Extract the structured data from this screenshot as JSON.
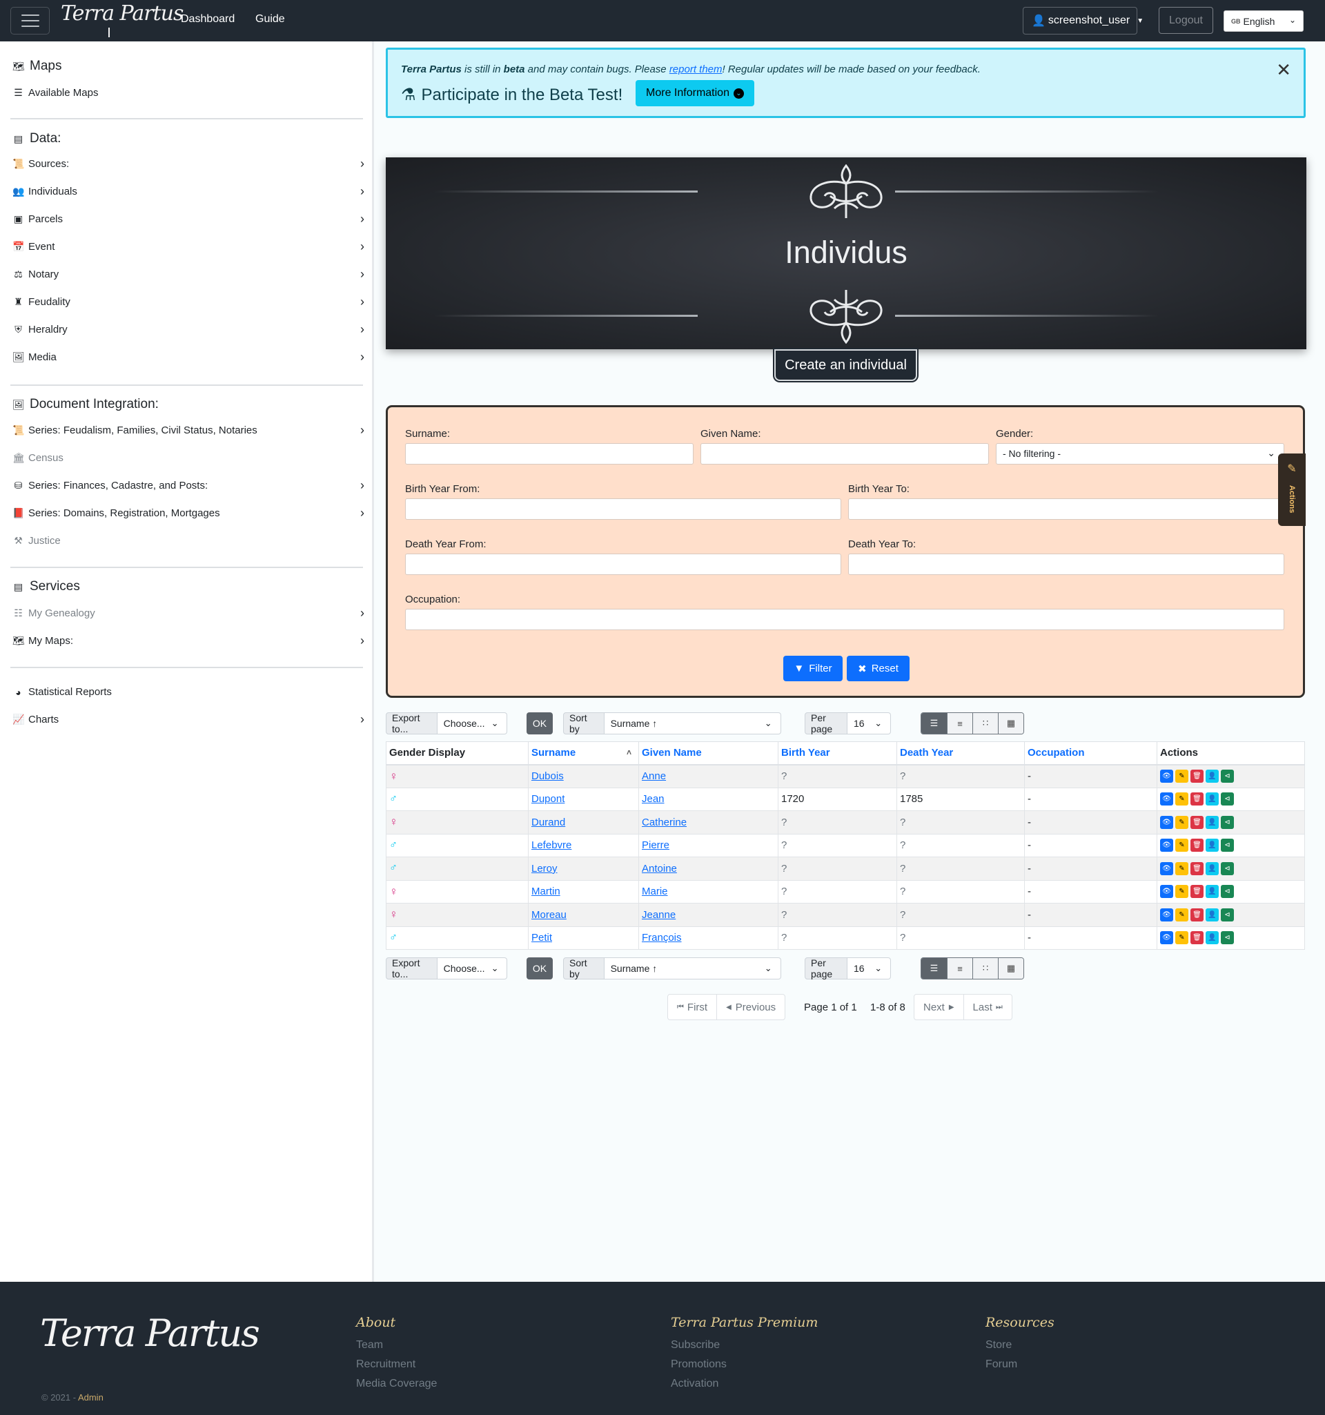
{
  "navbar": {
    "brand": "Terra Partus",
    "links": [
      "Dashboard",
      "Guide"
    ],
    "user": "screenshot_user",
    "logout": "Logout",
    "language": {
      "flag": "GB",
      "label": "English"
    }
  },
  "sidebar": {
    "maps_heading": "Maps",
    "available_maps": "Available Maps",
    "data_heading": "Data:",
    "data_items": [
      {
        "label": "Sources:",
        "icon": "scroll-icon"
      },
      {
        "label": "Individuals",
        "icon": "users-icon"
      },
      {
        "label": "Parcels",
        "icon": "parcel-icon"
      },
      {
        "label": "Event",
        "icon": "calendar-icon"
      },
      {
        "label": "Notary",
        "icon": "scale-icon"
      },
      {
        "label": "Feudality",
        "icon": "castle-icon"
      },
      {
        "label": "Heraldry",
        "icon": "shield-icon"
      },
      {
        "label": "Media",
        "icon": "images-icon"
      }
    ],
    "doc_heading": "Document Integration:",
    "doc_items": [
      {
        "label": "Series: Feudalism, Families, Civil Status, Notaries",
        "arrow": true,
        "muted": false
      },
      {
        "label": "Census",
        "arrow": false,
        "muted": true
      },
      {
        "label": "Series: Finances, Cadastre, and Posts:",
        "arrow": true,
        "muted": false
      },
      {
        "label": "Series: Domains, Registration, Mortgages",
        "arrow": true,
        "muted": false
      },
      {
        "label": "Justice",
        "arrow": false,
        "muted": true
      }
    ],
    "services_heading": "Services",
    "services_items": [
      {
        "label": "My Genealogy",
        "muted": true
      },
      {
        "label": "My Maps:",
        "muted": false
      }
    ],
    "reports": "Statistical Reports",
    "charts": "Charts"
  },
  "alert": {
    "brand": "Terra Partus",
    "text_1": " is still in ",
    "beta": "beta",
    "text_2": " and may contain bugs. Please ",
    "link": "report them",
    "text_3": "! Regular updates will be made based on your feedback.",
    "title": "Participate in the Beta Test!",
    "button": "More Information"
  },
  "banner": {
    "title": "Individus",
    "create_button": "Create an individual"
  },
  "filters": {
    "surname": "Surname:",
    "given_name": "Given Name:",
    "gender": "Gender:",
    "gender_value": "- No filtering -",
    "birth_from": "Birth Year From:",
    "birth_to": "Birth Year To:",
    "death_from": "Death Year From:",
    "death_to": "Death Year To:",
    "occupation": "Occupation:",
    "filter_btn": "Filter",
    "reset_btn": "Reset",
    "actions_tab": "Actions"
  },
  "toolbar": {
    "export_label": "Export to...",
    "export_value": "Choose...",
    "ok": "OK",
    "sort_label": "Sort by",
    "sort_value": "Surname ↑",
    "per_page_label": "Per page",
    "per_page_value": "16"
  },
  "table": {
    "headers": [
      "Gender Display",
      "Surname",
      "Given Name",
      "Birth Year",
      "Death Year",
      "Occupation",
      "Actions"
    ],
    "rows": [
      {
        "gender": "F",
        "surname": "Dubois",
        "given": "Anne",
        "birth": "?",
        "death": "?",
        "occupation": "-"
      },
      {
        "gender": "M",
        "surname": "Dupont",
        "given": "Jean",
        "birth": "1720",
        "death": "1785",
        "occupation": "-"
      },
      {
        "gender": "F",
        "surname": "Durand",
        "given": "Catherine",
        "birth": "?",
        "death": "?",
        "occupation": "-"
      },
      {
        "gender": "M",
        "surname": "Lefebvre",
        "given": "Pierre",
        "birth": "?",
        "death": "?",
        "occupation": "-"
      },
      {
        "gender": "M",
        "surname": "Leroy",
        "given": "Antoine",
        "birth": "?",
        "death": "?",
        "occupation": "-"
      },
      {
        "gender": "F",
        "surname": "Martin",
        "given": "Marie",
        "birth": "?",
        "death": "?",
        "occupation": "-"
      },
      {
        "gender": "F",
        "surname": "Moreau",
        "given": "Jeanne",
        "birth": "?",
        "death": "?",
        "occupation": "-"
      },
      {
        "gender": "M",
        "surname": "Petit",
        "given": "François",
        "birth": "?",
        "death": "?",
        "occupation": "-"
      }
    ]
  },
  "pagination": {
    "first": "First",
    "previous": "Previous",
    "page_info": "Page 1 of 1",
    "range": "1-8 of 8",
    "next": "Next",
    "last": "Last"
  },
  "footer": {
    "brand": "Terra Partus",
    "copy": "© 2021 - ",
    "admin": "Admin",
    "columns": [
      {
        "title": "About",
        "links": [
          "Team",
          "Recruitment",
          "Media Coverage"
        ]
      },
      {
        "title": "Terra Partus Premium",
        "links": [
          "Subscribe",
          "Promotions",
          "Activation"
        ]
      },
      {
        "title": "Resources",
        "links": [
          "Store",
          "Forum"
        ]
      }
    ]
  }
}
